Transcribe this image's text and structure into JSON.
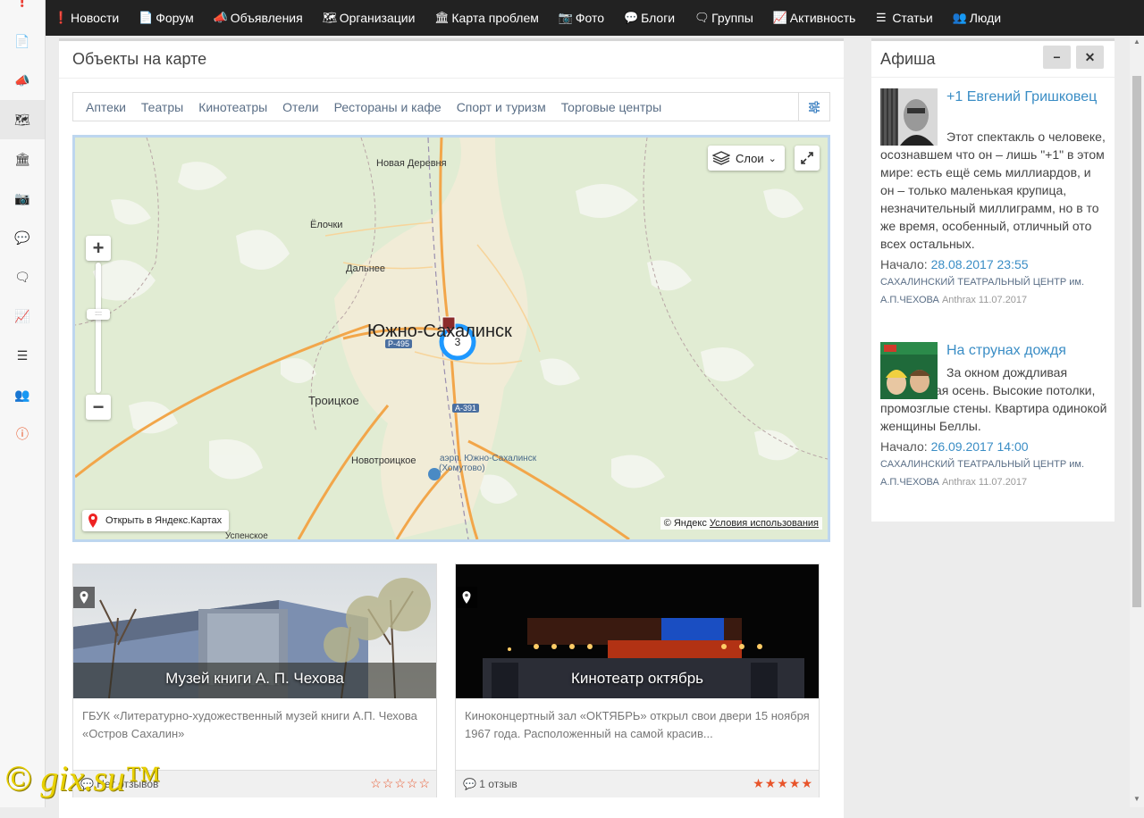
{
  "topnav": [
    {
      "label": "Новости",
      "icon": "info-icon"
    },
    {
      "label": "Форум",
      "icon": "document-icon"
    },
    {
      "label": "Объявления",
      "icon": "megaphone-icon"
    },
    {
      "label": "Организации",
      "icon": "map-icon"
    },
    {
      "label": "Карта проблем",
      "icon": "institution-icon"
    },
    {
      "label": "Фото",
      "icon": "image-icon"
    },
    {
      "label": "Блоги",
      "icon": "comment-icon"
    },
    {
      "label": "Группы",
      "icon": "comments-icon"
    },
    {
      "label": "Активность",
      "icon": "chart-icon"
    },
    {
      "label": "Статьи",
      "icon": "list-icon"
    },
    {
      "label": "Люди",
      "icon": "users-icon"
    }
  ],
  "sidebar_icons": [
    "info-icon",
    "document-icon",
    "megaphone-icon",
    "map-icon",
    "institution-icon",
    "image-icon",
    "comment-icon",
    "comments-icon",
    "chart-icon",
    "list-icon",
    "users-icon",
    "info-circle-icon"
  ],
  "main": {
    "title": "Объекты на карте",
    "filters": [
      "Аптеки",
      "Театры",
      "Кинотеатры",
      "Отели",
      "Рестораны и кафе",
      "Спорт и туризм",
      "Торговые центры"
    ]
  },
  "map": {
    "layers_label": "Слои",
    "open_label": "Открыть в Яндекс.Картах",
    "copyright": "© Яндекс",
    "terms": "Условия использования",
    "city": "Южно-Сахалинск",
    "cluster_count": "3",
    "labels": {
      "novaya_derevnya": "Новая Деревня",
      "elochki": "Ёлочки",
      "dalnee": "Дальнее",
      "troitskoe": "Троицкое",
      "novotroitskoe": "Новотроицкое",
      "airport1": "аэрп. Южно-Сахалинск",
      "airport2": "(Хомутово)",
      "uspenskoe": "Успенское",
      "road1": "Р-495",
      "road2": "А-391"
    }
  },
  "cards": [
    {
      "title": "Музей книги А. П. Чехова",
      "desc": "ГБУК «Литературно-художественный музей книги А.П. Чехова «Остров Сахалин»",
      "reviews": "Нет отзывов",
      "rating": 0
    },
    {
      "title": "Кинотеатр октябрь",
      "desc": "Киноконцертный зал «ОКТЯБРЬ» открыл свои двери 15 ноября 1967 года. Расположенный на самой красив...",
      "reviews": "1 отзыв",
      "rating": 5
    }
  ],
  "afisha": {
    "title": "Афиша",
    "events": [
      {
        "title": "+1 Евгений Гришковец",
        "text": "Этот спектакль о человеке, осознавшем что он – лишь \"+1\" в этом мире: есть ещё семь миллиардов, и он – только маленькая крупица, незначительный миллиграмм, но в то же время, особенный, отличный ото всех остальных.",
        "start_label": "Начало:",
        "start": "28.08.2017 23:55",
        "venue": "САХАЛИНСКИЙ ТЕАТРАЛЬНЫЙ ЦЕНТР им. А.П.ЧЕХОВА",
        "author": "Anthrax",
        "date": "11.07.2017"
      },
      {
        "title": "На струнах дождя",
        "text": "За окном дождливая лондонская осень. Высокие потолки, промозглые стены. Квартира одинокой женщины Беллы.",
        "start_label": "Начало:",
        "start": "26.09.2017 14:00",
        "venue": "САХАЛИНСКИЙ ТЕАТРАЛЬНЫЙ ЦЕНТР им. А.П.ЧЕХОВА",
        "author": "Anthrax",
        "date": "11.07.2017"
      }
    ]
  },
  "watermark": "© gix.su™",
  "colors": {
    "link": "#3a8dc5",
    "accent_star": "#e8542a",
    "nav_bg": "#222222"
  }
}
